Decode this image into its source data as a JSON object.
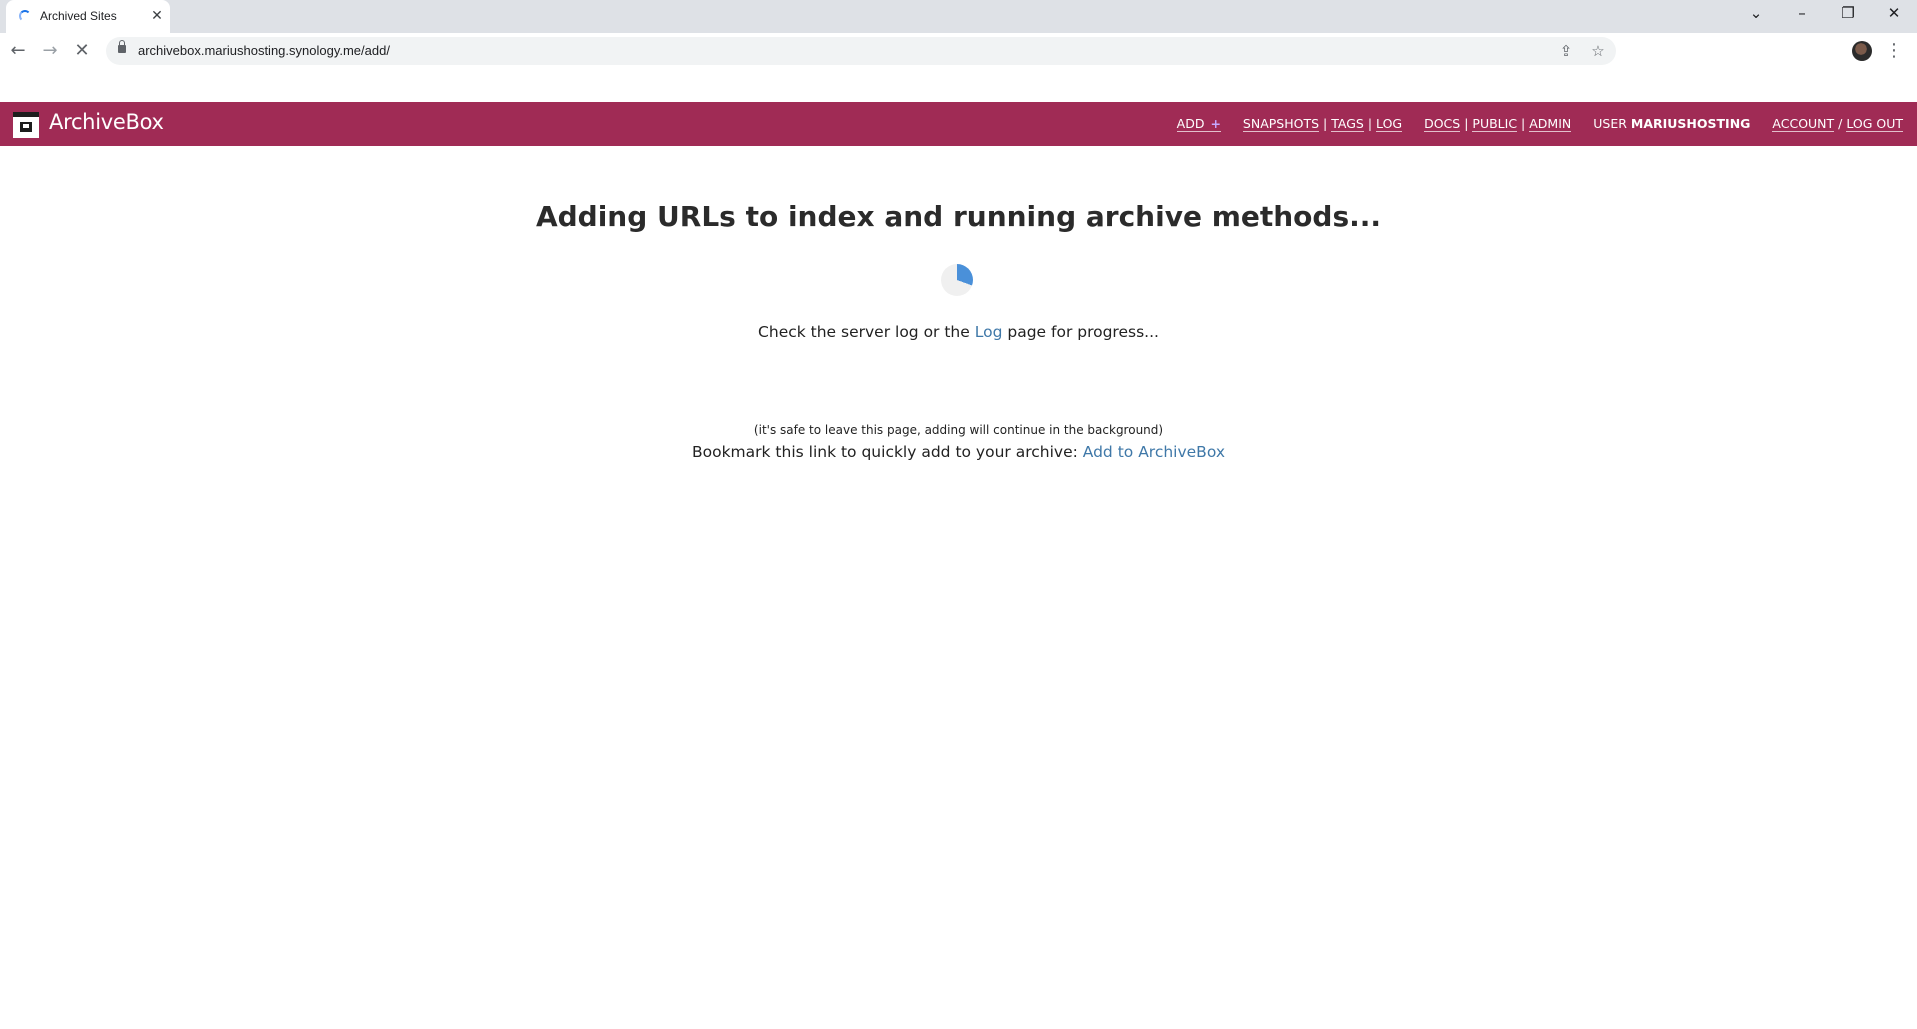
{
  "browser": {
    "tab_title": "Archived Sites",
    "url": "archivebox.mariushosting.synology.me/add/"
  },
  "header": {
    "brand": "ArchiveBox",
    "nav": {
      "add": "ADD",
      "snapshots": "SNAPSHOTS",
      "tags": "TAGS",
      "log": "LOG",
      "docs": "DOCS",
      "public": "PUBLIC",
      "admin": "ADMIN",
      "user_prefix": "USER",
      "user_name": "MARIUSHOSTING",
      "account": "ACCOUNT",
      "logout": "LOG OUT",
      "sep_bar": "|",
      "sep_slash": "/"
    },
    "colors": {
      "bar": "#a02b55",
      "text": "#ffffff"
    }
  },
  "main": {
    "heading": "Adding URLs to index and running archive methods...",
    "progress_prefix": "Check the server log or the",
    "progress_link": "Log",
    "progress_suffix": "page for progress...",
    "note": "(it's safe to leave this page, adding will continue in the background)",
    "bookmark_prefix": "Bookmark this link to quickly add to your archive:",
    "bookmark_link": "Add to ArchiveBox",
    "colors": {
      "link": "#3f78a8",
      "loader": "#4a90d9"
    }
  }
}
